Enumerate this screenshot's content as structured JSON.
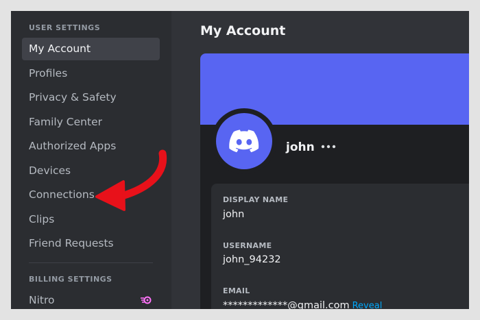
{
  "sidebar": {
    "user_settings_header": "USER SETTINGS",
    "items": [
      {
        "label": "My Account"
      },
      {
        "label": "Profiles"
      },
      {
        "label": "Privacy & Safety"
      },
      {
        "label": "Family Center"
      },
      {
        "label": "Authorized Apps"
      },
      {
        "label": "Devices"
      },
      {
        "label": "Connections"
      },
      {
        "label": "Clips"
      },
      {
        "label": "Friend Requests"
      }
    ],
    "billing_settings_header": "BILLING SETTINGS",
    "billing_items": [
      {
        "label": "Nitro",
        "icon": "nitro-icon"
      }
    ]
  },
  "main": {
    "title": "My Account",
    "profile": {
      "name": "john",
      "banner_color": "#5865f2"
    },
    "fields": [
      {
        "label": "DISPLAY NAME",
        "value": "john"
      },
      {
        "label": "USERNAME",
        "value": "john_94232"
      },
      {
        "label": "EMAIL",
        "value": "*************@gmail.com",
        "action": "Reveal"
      }
    ]
  },
  "colors": {
    "brand": "#5865f2",
    "arrow": "#e8111a",
    "nitro": "#ff73fa"
  }
}
